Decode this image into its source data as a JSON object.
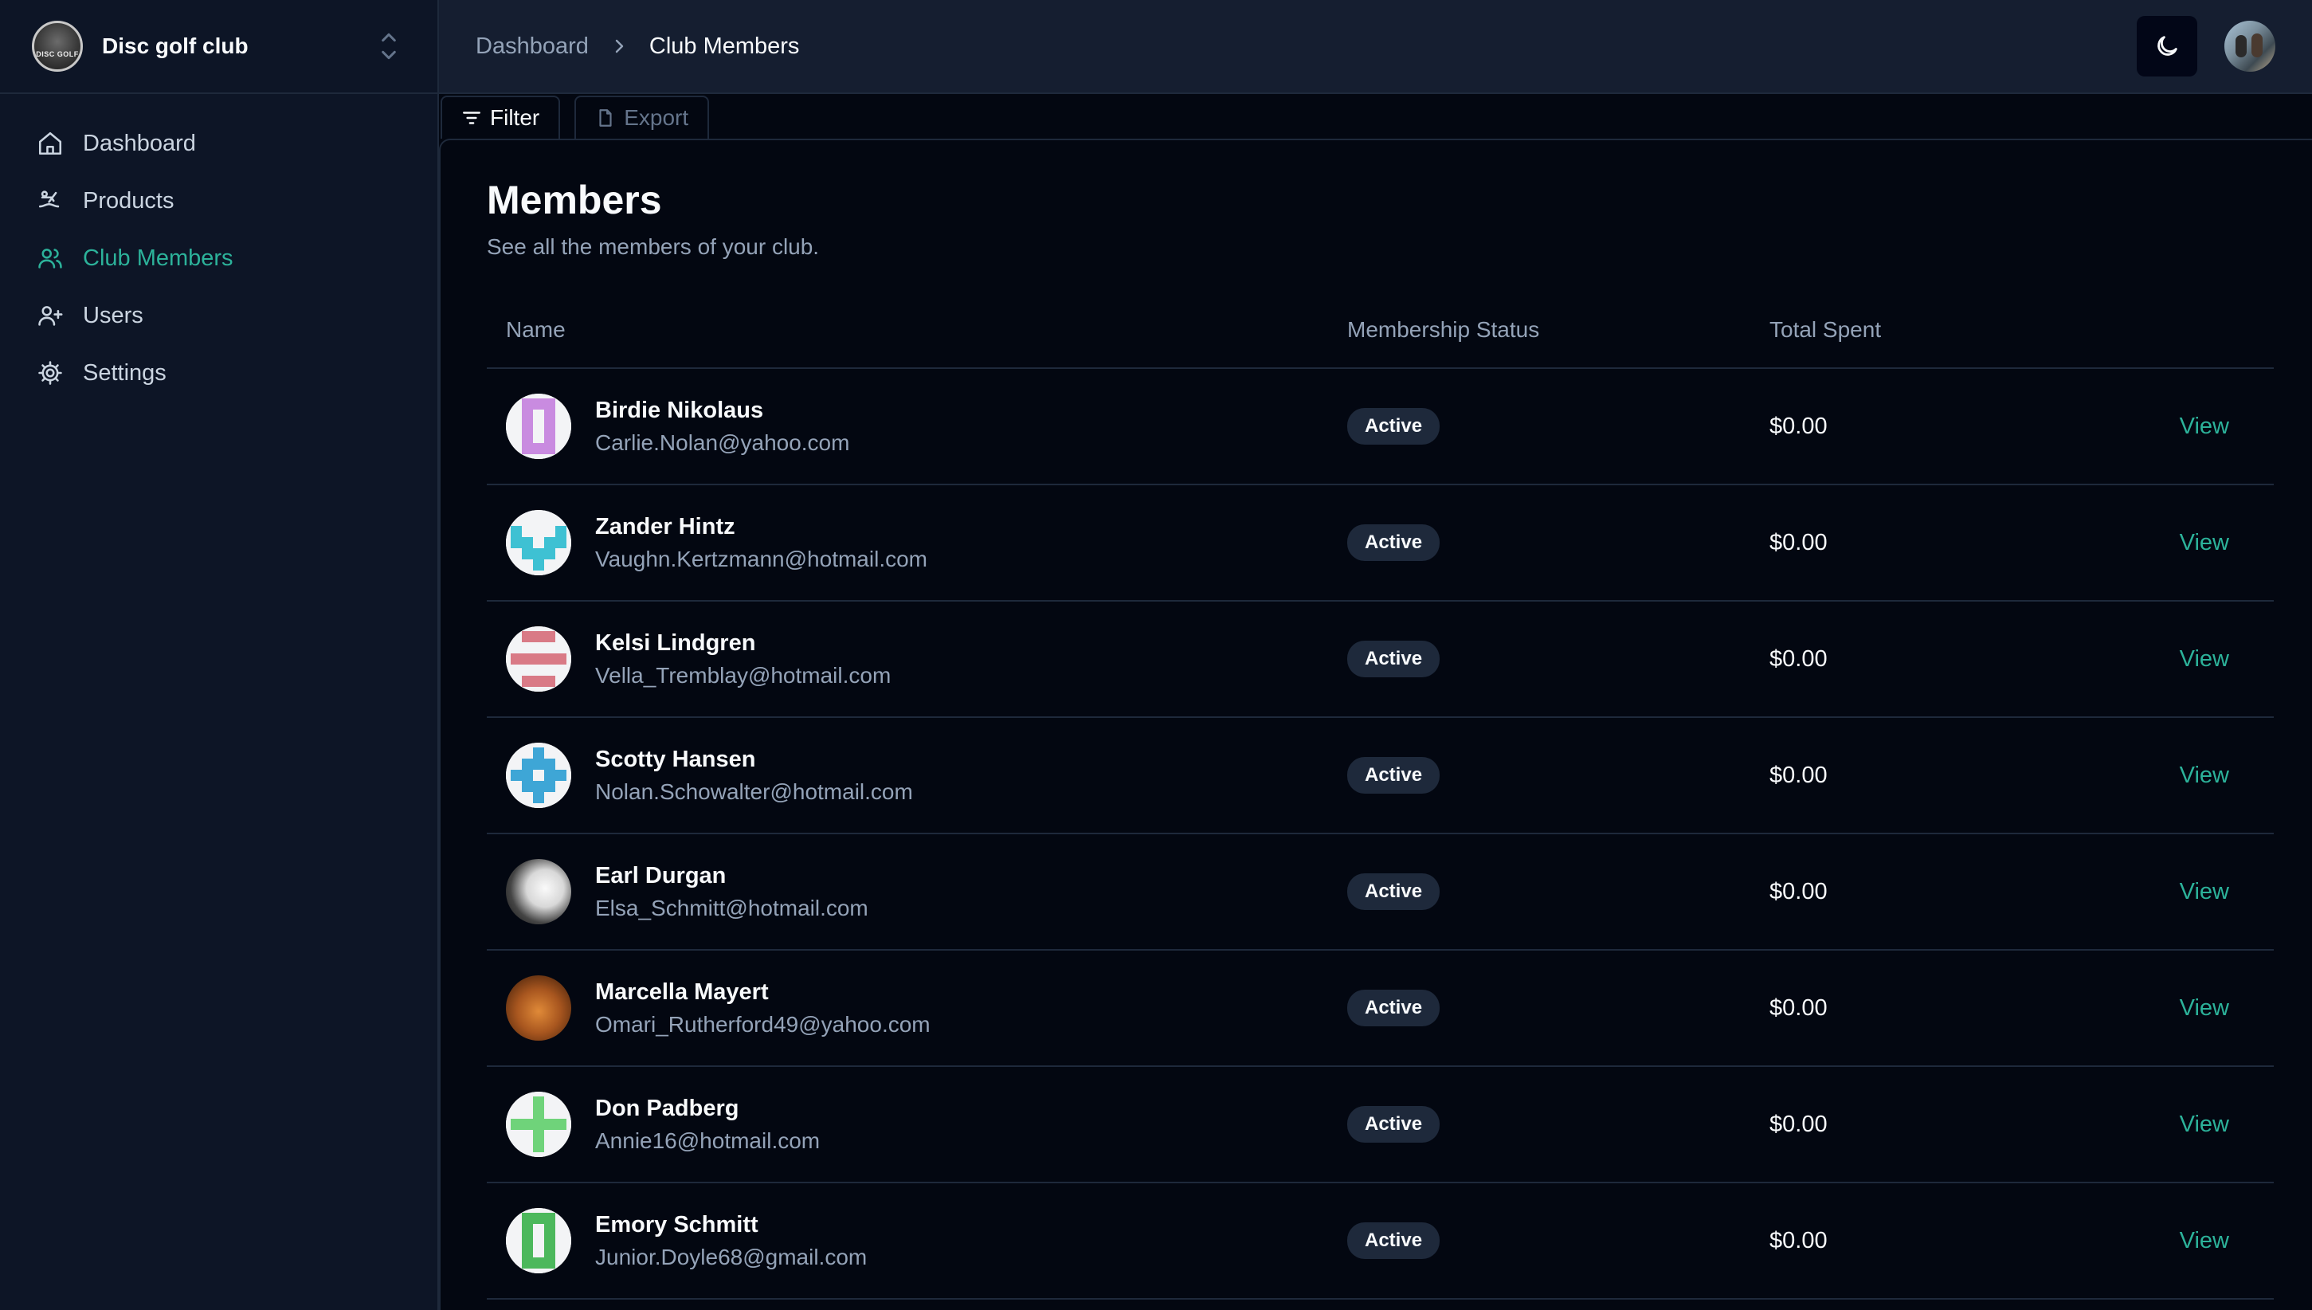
{
  "brand": {
    "name": "Disc golf club",
    "logo_text": "DISC GOLF"
  },
  "nav": [
    {
      "label": "Dashboard",
      "icon": "home-icon",
      "active": false
    },
    {
      "label": "Products",
      "icon": "products-icon",
      "active": false
    },
    {
      "label": "Club Members",
      "icon": "members-icon",
      "active": true
    },
    {
      "label": "Users",
      "icon": "user-plus-icon",
      "active": false
    },
    {
      "label": "Settings",
      "icon": "gear-icon",
      "active": false
    }
  ],
  "breadcrumb": {
    "parent": "Dashboard",
    "current": "Club Members"
  },
  "toolbar": {
    "filter_label": "Filter",
    "export_label": "Export"
  },
  "page": {
    "title": "Members",
    "subtitle": "See all the members of your club."
  },
  "table": {
    "headers": {
      "name": "Name",
      "status": "Membership Status",
      "spent": "Total Spent"
    },
    "view_label": "View",
    "rows": [
      {
        "name": "Birdie Nikolaus",
        "email": "Carlie.Nolan@yahoo.com",
        "status": "Active",
        "spent": "$0.00",
        "avatar": "identicon",
        "color": "#c98be0",
        "pattern": "u"
      },
      {
        "name": "Zander Hintz",
        "email": "Vaughn.Kertzmann@hotmail.com",
        "status": "Active",
        "spent": "$0.00",
        "avatar": "identicon",
        "color": "#3ec1d3",
        "pattern": "w"
      },
      {
        "name": "Kelsi Lindgren",
        "email": "Vella_Tremblay@hotmail.com",
        "status": "Active",
        "spent": "$0.00",
        "avatar": "identicon",
        "color": "#d97a86",
        "pattern": "bars"
      },
      {
        "name": "Scotty Hansen",
        "email": "Nolan.Schowalter@hotmail.com",
        "status": "Active",
        "spent": "$0.00",
        "avatar": "identicon",
        "color": "#3ea6d6",
        "pattern": "cross"
      },
      {
        "name": "Earl Durgan",
        "email": "Elsa_Schmitt@hotmail.com",
        "status": "Active",
        "spent": "$0.00",
        "avatar": "photo-earl",
        "color": "#ffffff",
        "pattern": ""
      },
      {
        "name": "Marcella Mayert",
        "email": "Omari_Rutherford49@yahoo.com",
        "status": "Active",
        "spent": "$0.00",
        "avatar": "photo-marcella",
        "color": "#a8561f",
        "pattern": ""
      },
      {
        "name": "Don Padberg",
        "email": "Annie16@hotmail.com",
        "status": "Active",
        "spent": "$0.00",
        "avatar": "identicon",
        "color": "#6fd37a",
        "pattern": "plus"
      },
      {
        "name": "Emory Schmitt",
        "email": "Junior.Doyle68@gmail.com",
        "status": "Active",
        "spent": "$0.00",
        "avatar": "identicon",
        "color": "#4cb85c",
        "pattern": "u"
      }
    ]
  },
  "colors": {
    "accent": "#2cb29a",
    "background": "#030711",
    "sidebar": "#0d1526",
    "topbar": "#151e30"
  }
}
